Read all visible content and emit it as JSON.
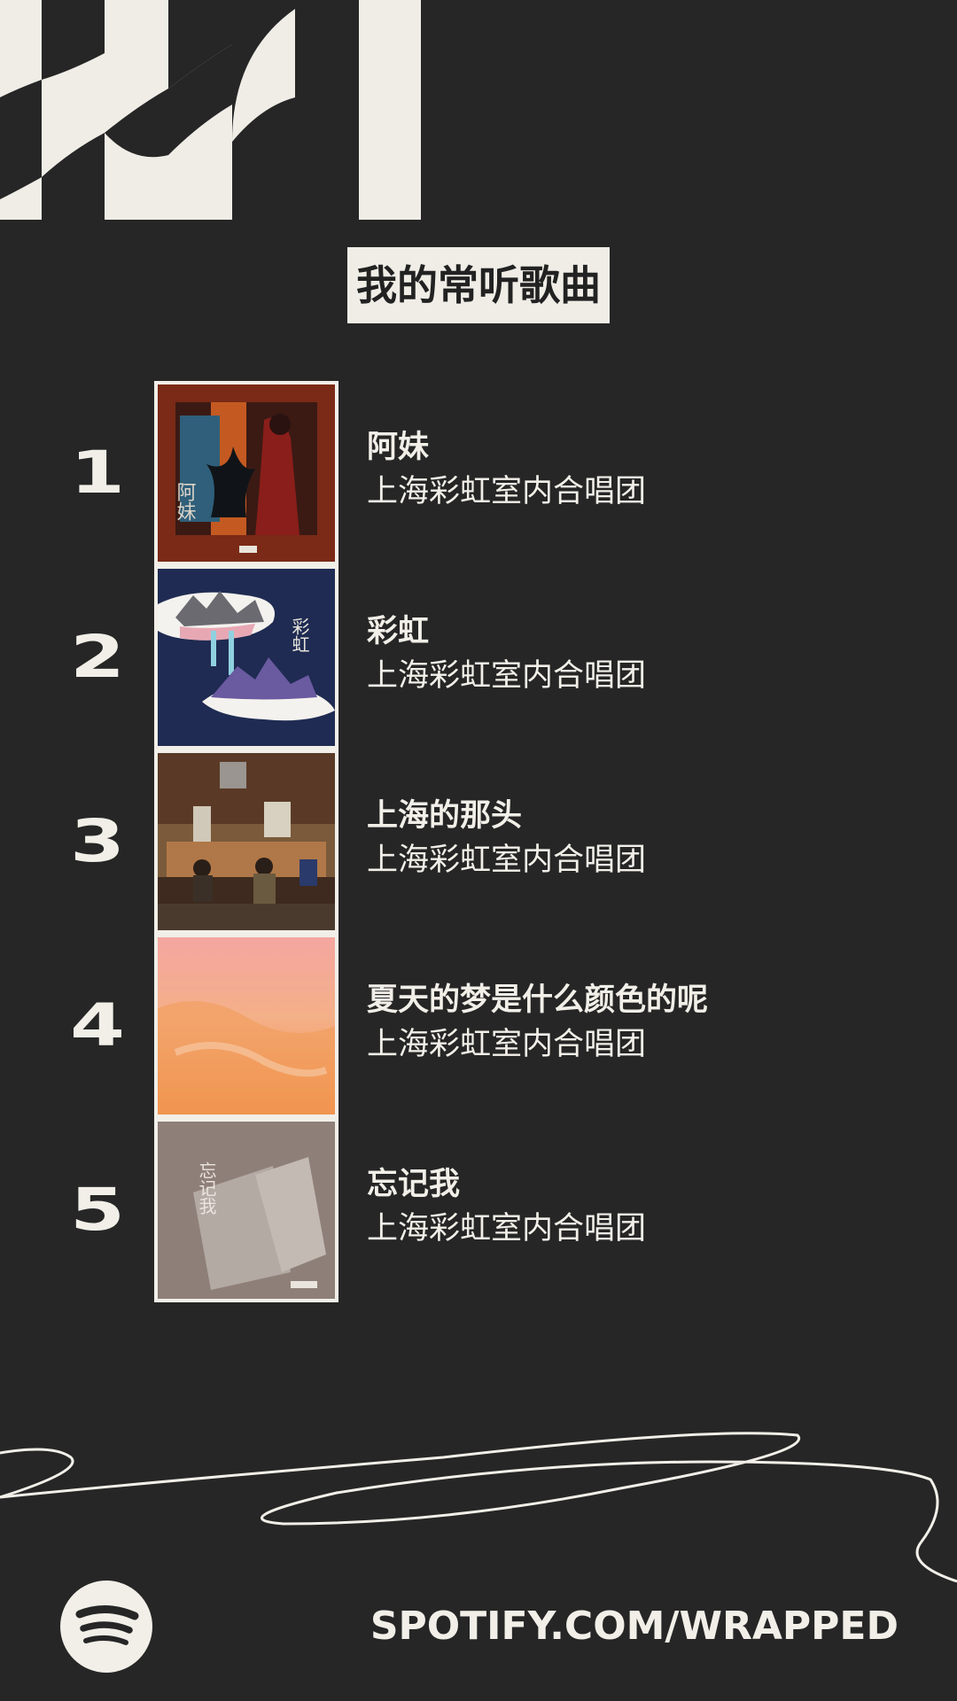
{
  "title": "我的常听歌曲",
  "tracks": [
    {
      "rank": "1",
      "title": "阿妹",
      "artist": "上海彩虹室内合唱团",
      "cover_text": "阿妹"
    },
    {
      "rank": "2",
      "title": "彩虹",
      "artist": "上海彩虹室内合唱团",
      "cover_text": "彩虹"
    },
    {
      "rank": "3",
      "title": "上海的那头",
      "artist": "上海彩虹室内合唱团",
      "cover_text": ""
    },
    {
      "rank": "4",
      "title": "夏天的梦是什么颜色的呢",
      "artist": "上海彩虹室内合唱团",
      "cover_text": ""
    },
    {
      "rank": "5",
      "title": "忘记我",
      "artist": "上海彩虹室内合唱团",
      "cover_text": "忘记我"
    }
  ],
  "footer": {
    "url": "SPOTIFY.COM/WRAPPED",
    "logo_icon": "spotify-logo-icon"
  },
  "colors": {
    "background": "#262626",
    "foreground": "#f1efe8",
    "title_text": "#222222"
  }
}
